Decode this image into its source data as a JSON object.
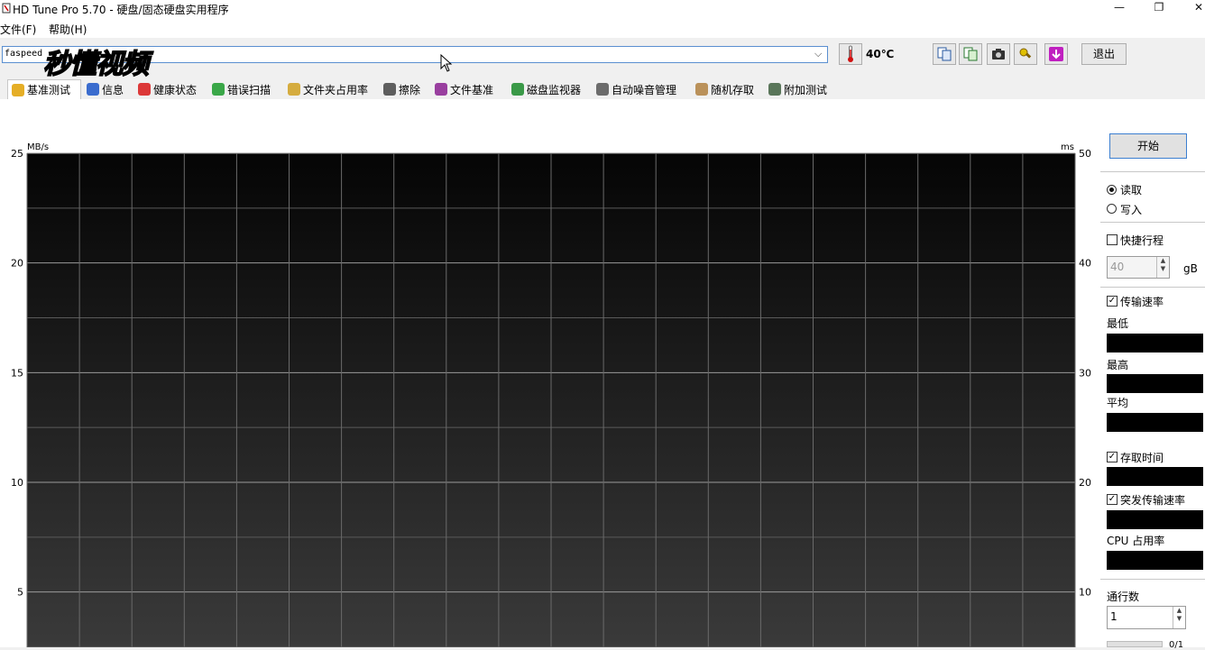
{
  "window": {
    "title": "HD Tune Pro 5.70 - 硬盘/固态硬盘实用程序",
    "minimize": "—",
    "restore": "❐",
    "close": "✕"
  },
  "menu": {
    "items": [
      "文件(F)",
      "帮助(H)"
    ]
  },
  "toolbar": {
    "drive": "faspeed ...",
    "temperature": "40℃",
    "exit_label": "退出",
    "icons": [
      "copy-info-icon",
      "copy-report-icon",
      "screenshot-icon",
      "options-icon",
      "save-icon"
    ]
  },
  "watermark": "秒懂视频",
  "tabs": [
    {
      "label": "基准测试",
      "icon": "benchmark-icon",
      "color": "#e0a000"
    },
    {
      "label": "信息",
      "icon": "info-icon",
      "color": "#1a55c8"
    },
    {
      "label": "健康状态",
      "icon": "health-icon",
      "color": "#d81818"
    },
    {
      "label": "错误扫描",
      "icon": "error-scan-icon",
      "color": "#1a9a2a"
    },
    {
      "label": "文件夹占用率",
      "icon": "folder-icon",
      "color": "#d0a020"
    },
    {
      "label": "擦除",
      "icon": "erase-icon",
      "color": "#444444"
    },
    {
      "label": "文件基准",
      "icon": "file-benchmark-icon",
      "color": "#8a2090"
    },
    {
      "label": "磁盘监视器",
      "icon": "disk-monitor-icon",
      "color": "#1a8a2a"
    },
    {
      "label": "自动噪音管理",
      "icon": "noise-icon",
      "color": "#555555"
    },
    {
      "label": "随机存取",
      "icon": "random-access-icon",
      "color": "#b08040"
    },
    {
      "label": "附加测试",
      "icon": "extra-tests-icon",
      "color": "#406040"
    }
  ],
  "chart_data": {
    "type": "line",
    "y_left_label": "MB/s",
    "y_right_label": "ms",
    "y_left_ticks": [
      25,
      20,
      15,
      10,
      5
    ],
    "y_right_ticks": [
      50,
      40,
      30,
      20,
      10
    ],
    "ylim_left": [
      0,
      25
    ],
    "ylim_right": [
      0,
      50
    ],
    "grid": true,
    "series": []
  },
  "panel": {
    "start_label": "开始",
    "read_label": "读取",
    "write_label": "写入",
    "mode": "read",
    "short_stroke_label": "快捷行程",
    "short_stroke_checked": false,
    "short_stroke_value": "40",
    "short_stroke_unit": "gB",
    "transfer_rate_label": "传输速率",
    "transfer_rate_checked": true,
    "min_label": "最低",
    "max_label": "最高",
    "avg_label": "平均",
    "access_time_label": "存取时间",
    "access_time_checked": true,
    "burst_rate_label": "突发传输速率",
    "burst_rate_checked": true,
    "cpu_label": "CPU 占用率",
    "passes_label": "通行数",
    "passes_value": "1",
    "progress_label": "0/1"
  }
}
